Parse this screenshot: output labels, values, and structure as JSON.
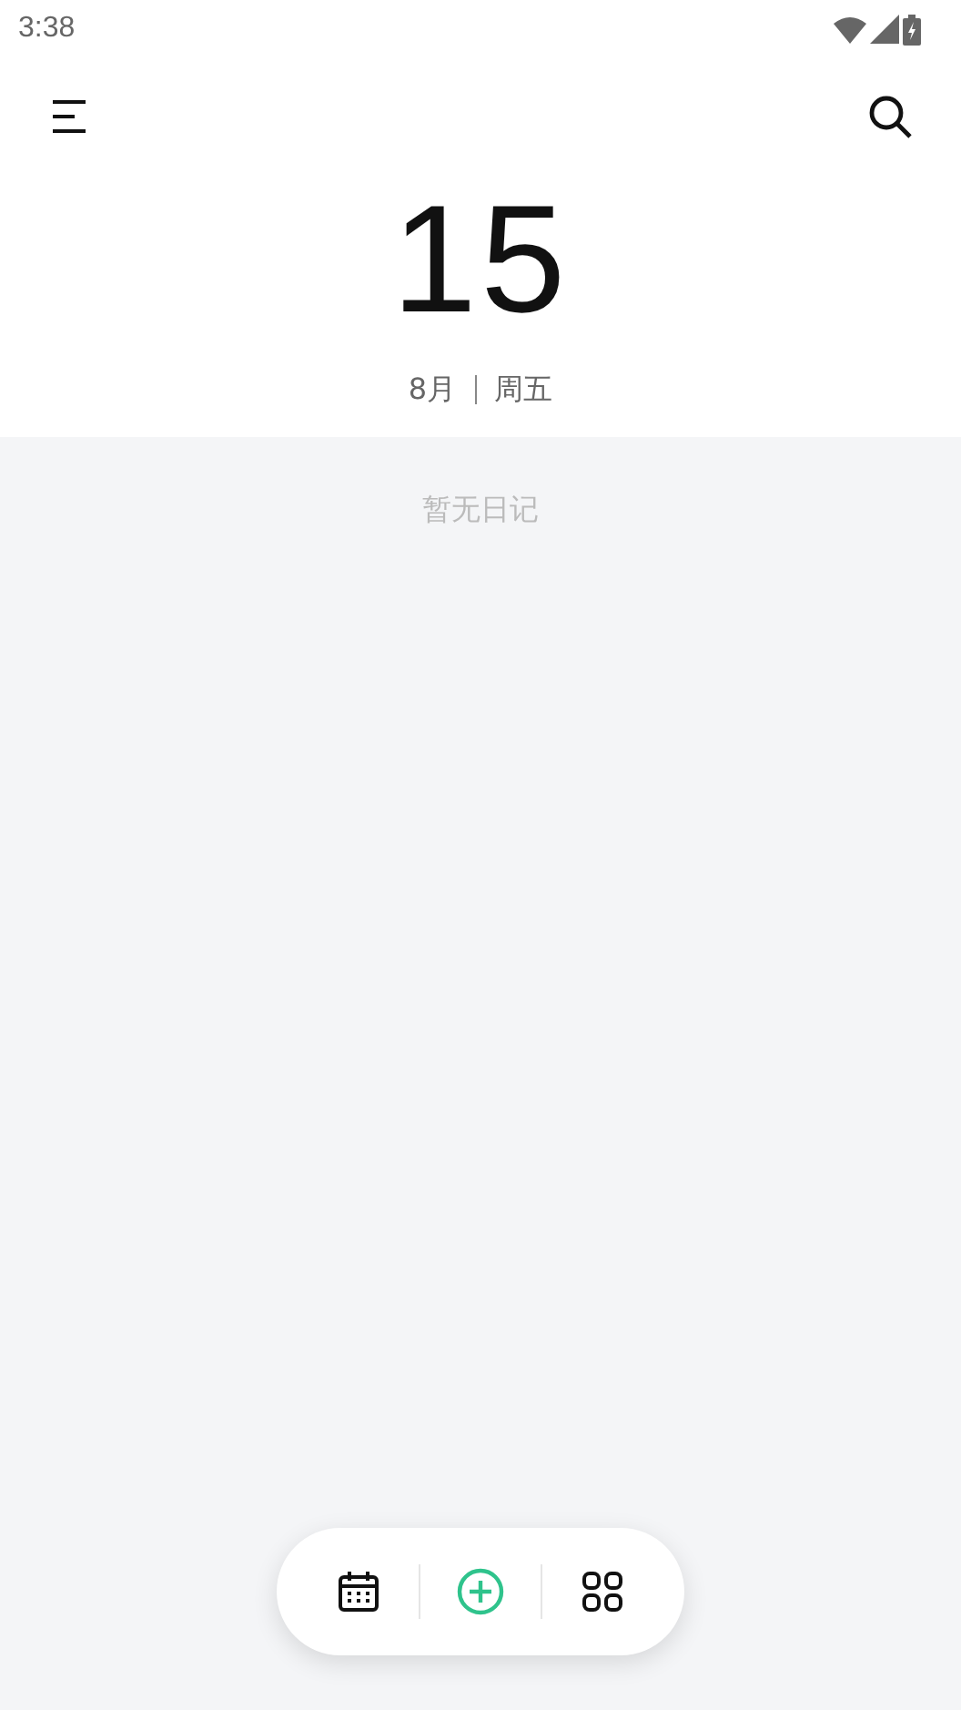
{
  "status_bar": {
    "time": "3:38"
  },
  "date": {
    "day": "15",
    "month": "8月",
    "weekday": "周五"
  },
  "empty_message": "暂无日记"
}
